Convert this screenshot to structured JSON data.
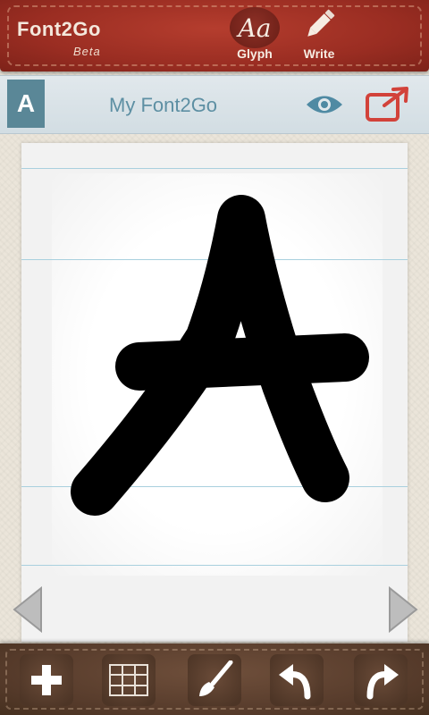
{
  "app": {
    "logo_text": "Font2Go",
    "logo_sub": "Beta"
  },
  "toolbar_top": {
    "glyph_icon_text": "Aa",
    "glyph_label": "Glyph",
    "write_label": "Write"
  },
  "titlebar": {
    "current_letter": "A",
    "font_name": "My Font2Go"
  },
  "colors": {
    "topbar": "#9a2d22",
    "titlebar": "#d8e2e7",
    "accent_blue": "#4f8aa3",
    "export_red": "#d2423a",
    "bottombar": "#553a2a"
  },
  "bottom_tools": [
    "add-icon",
    "grid-icon",
    "brush-icon",
    "undo-icon",
    "redo-icon"
  ]
}
